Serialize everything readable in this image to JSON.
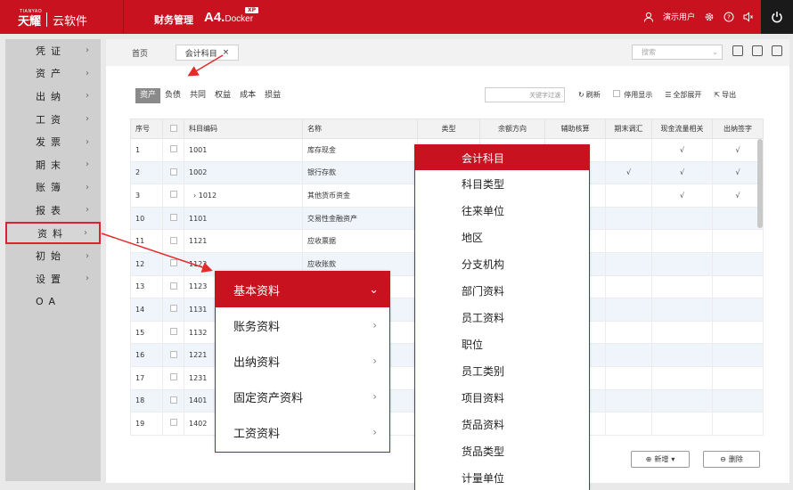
{
  "topbar": {
    "logo_mark": "TIANYAO",
    "logo_main": "天耀",
    "logo_sub": "云软件",
    "app_name": "财务管理",
    "product": "A4.",
    "product_suffix": "Docker",
    "badge": "XP",
    "user": "演示用户",
    "accent_color": "#c8121f"
  },
  "sidebar": {
    "items": [
      {
        "label": "凭证"
      },
      {
        "label": "资产"
      },
      {
        "label": "出纳"
      },
      {
        "label": "工资"
      },
      {
        "label": "发票"
      },
      {
        "label": "期末"
      },
      {
        "label": "账簿"
      },
      {
        "label": "报表"
      },
      {
        "label": "资料"
      },
      {
        "label": "初始"
      },
      {
        "label": "设置"
      },
      {
        "label": "OA"
      }
    ]
  },
  "tabs": {
    "home": "首页",
    "active": "会计科目",
    "search_placeholder": "搜索"
  },
  "filter": {
    "tabs": [
      "资产",
      "负债",
      "共同",
      "权益",
      "成本",
      "损益"
    ],
    "keyword_placeholder": "关键字过滤",
    "refresh": "刷新",
    "show_disabled": "停用显示",
    "expand_all": "全部展开",
    "export": "导出"
  },
  "table": {
    "headers": [
      "序号",
      "",
      "科目编码",
      "名称",
      "类型",
      "余额方向",
      "辅助核算",
      "期末调汇",
      "现金流量相关",
      "出纳签字"
    ],
    "rows": [
      {
        "no": "1",
        "code": "1001",
        "name": "库存现金",
        "fx": "",
        "cash": "√",
        "sign": "√"
      },
      {
        "no": "2",
        "code": "1002",
        "name": "银行存款",
        "fx": "√",
        "cash": "√",
        "sign": "√"
      },
      {
        "no": "3",
        "code": "›  1012",
        "name": "其他货币资金",
        "fx": "",
        "cash": "√",
        "sign": "√"
      },
      {
        "no": "10",
        "code": "1101",
        "name": "交易性金融资产",
        "fx": "",
        "cash": "",
        "sign": ""
      },
      {
        "no": "11",
        "code": "1121",
        "name": "应收票据",
        "fx": "",
        "cash": "",
        "sign": ""
      },
      {
        "no": "12",
        "code": "1122",
        "name": "应收账款",
        "fx": "",
        "cash": "",
        "sign": ""
      },
      {
        "no": "13",
        "code": "1123",
        "name": "",
        "fx": "",
        "cash": "",
        "sign": ""
      },
      {
        "no": "14",
        "code": "1131",
        "name": "",
        "fx": "",
        "cash": "",
        "sign": ""
      },
      {
        "no": "15",
        "code": "1132",
        "name": "",
        "fx": "",
        "cash": "",
        "sign": ""
      },
      {
        "no": "16",
        "code": "1221",
        "name": "",
        "fx": "",
        "cash": "",
        "sign": ""
      },
      {
        "no": "17",
        "code": "1231",
        "name": "",
        "fx": "",
        "cash": "",
        "sign": ""
      },
      {
        "no": "18",
        "code": "1401",
        "name": "",
        "fx": "",
        "cash": "",
        "sign": ""
      },
      {
        "no": "19",
        "code": "1402",
        "name": "",
        "fx": "",
        "cash": "",
        "sign": ""
      }
    ]
  },
  "buttons": {
    "add": "新增",
    "delete": "删除"
  },
  "menu_basic": {
    "title": "基本资料",
    "items": [
      "账务资料",
      "出纳资料",
      "固定资产资料",
      "工资资料"
    ]
  },
  "menu_sub": {
    "title": "会计科目",
    "items": [
      "科目类型",
      "往来单位",
      "地区",
      "分支机构",
      "部门资料",
      "员工资料",
      "职位",
      "员工类别",
      "项目资料",
      "货品资料",
      "货品类型",
      "计量单位"
    ]
  }
}
